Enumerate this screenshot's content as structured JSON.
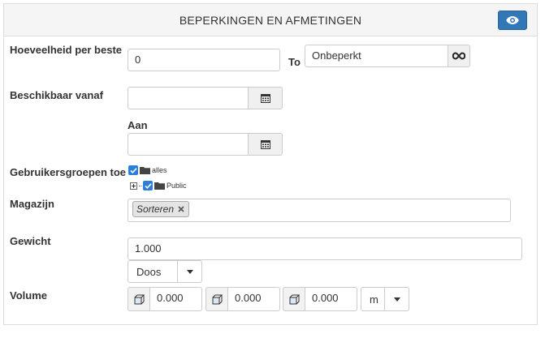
{
  "header": {
    "title": "BEPERKINGEN EN AFMETINGEN",
    "toggle_icon": "eye-icon"
  },
  "order_quantity": {
    "label": "Hoeveelheid per beste",
    "from_value": "0",
    "to_label": "To",
    "to_value": "Onbeperkt",
    "unlimited_icon": "infinity-icon"
  },
  "availability": {
    "from_label": "Beschikbaar vanaf",
    "from_value": "",
    "to_label": "Aan",
    "to_value": "",
    "calendar_icon": "calendar-icon"
  },
  "user_groups": {
    "label": "Gebruikersgroepen toe",
    "tree": [
      {
        "label": "alles",
        "checked": true,
        "expandable": false
      },
      {
        "label": "Public",
        "checked": true,
        "expandable": true
      }
    ]
  },
  "warehouse": {
    "label": "Magazijn",
    "tags": [
      "Sorteren"
    ]
  },
  "weight": {
    "label": "Gewicht",
    "value": "1.000",
    "unit_selected": "Doos"
  },
  "volume": {
    "label": "Volume",
    "dimension_icon": "cube-icon",
    "values": [
      "0.000",
      "0.000",
      "0.000"
    ],
    "unit_selected": "m"
  },
  "colors": {
    "primary": "#3277b6",
    "checkbox": "#2c7fd8"
  }
}
